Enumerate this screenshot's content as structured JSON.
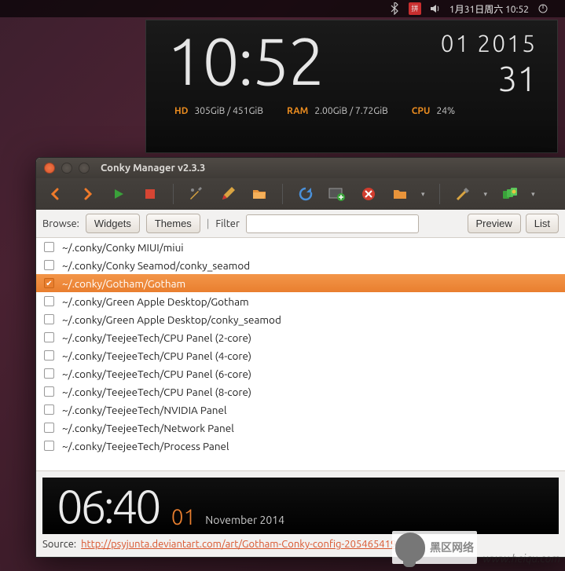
{
  "tray": {
    "datetime": "1月31日周六 10:52"
  },
  "conky": {
    "time": "10:52",
    "month_year": "01 2015",
    "day": "31",
    "hd_label": "HD",
    "hd_val": "305GiB / 451GiB",
    "ram_label": "RAM",
    "ram_val": "2.00GiB / 7.72GiB",
    "cpu_label": "CPU",
    "cpu_val": "24%"
  },
  "window": {
    "title": "Conky Manager v2.3.3",
    "browse_label": "Browse:",
    "widgets_label": "Widgets",
    "themes_label": "Themes",
    "filter_label": "Filter",
    "filter_value": "",
    "preview_label": "Preview",
    "list_label": "List",
    "items": [
      {
        "checked": false,
        "path": "~/.conky/Conky MIUI/miui"
      },
      {
        "checked": false,
        "path": "~/.conky/Conky Seamod/conky_seamod"
      },
      {
        "checked": true,
        "path": "~/.conky/Gotham/Gotham"
      },
      {
        "checked": false,
        "path": "~/.conky/Green Apple Desktop/Gotham"
      },
      {
        "checked": false,
        "path": "~/.conky/Green Apple Desktop/conky_seamod"
      },
      {
        "checked": false,
        "path": "~/.conky/TeejeeTech/CPU Panel (2-core)"
      },
      {
        "checked": false,
        "path": "~/.conky/TeejeeTech/CPU Panel (4-core)"
      },
      {
        "checked": false,
        "path": "~/.conky/TeejeeTech/CPU Panel (6-core)"
      },
      {
        "checked": false,
        "path": "~/.conky/TeejeeTech/CPU Panel (8-core)"
      },
      {
        "checked": false,
        "path": "~/.conky/TeejeeTech/NVIDIA Panel"
      },
      {
        "checked": false,
        "path": "~/.conky/TeejeeTech/Network Panel"
      },
      {
        "checked": false,
        "path": "~/.conky/TeejeeTech/Process Panel"
      }
    ],
    "preview": {
      "time": "06:40",
      "day": "01",
      "month_year": "November 2014"
    },
    "source_label": "Source:",
    "source_url": "http://psyjunta.deviantart.com/art/Gotham-Conky-config-205465419"
  },
  "watermark": {
    "cn": "黑区网络",
    "site": "www.heiqu.com"
  }
}
